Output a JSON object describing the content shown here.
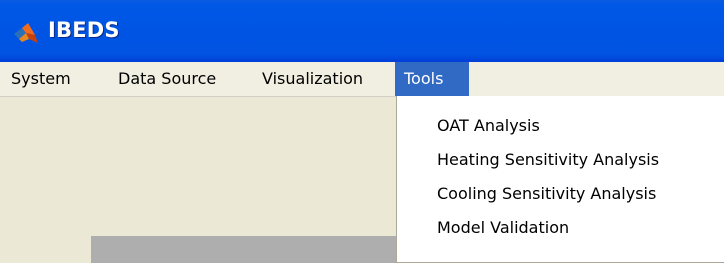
{
  "window": {
    "title": "IBEDS",
    "icon": "matlab-logo-icon"
  },
  "menubar": {
    "items": [
      {
        "label": "System"
      },
      {
        "label": "Data Source"
      },
      {
        "label": "Visualization"
      },
      {
        "label": "Tools"
      }
    ],
    "selected": "Tools"
  },
  "tools_menu": {
    "items": [
      {
        "label": "OAT Analysis"
      },
      {
        "label": "Heating Sensitivity Analysis"
      },
      {
        "label": "Cooling Sensitivity Analysis"
      },
      {
        "label": "Model Validation"
      }
    ]
  },
  "colors": {
    "titlebar": "#0055e5",
    "menu_highlight": "#316ac5",
    "menubar_bg": "#f1efe2"
  }
}
